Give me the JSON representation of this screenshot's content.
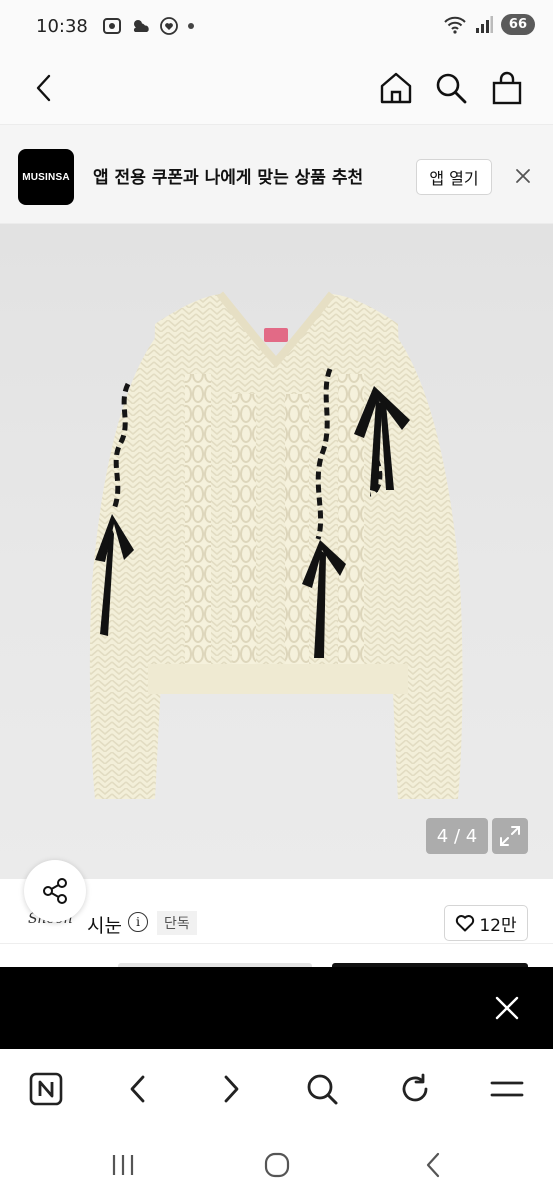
{
  "status_bar": {
    "time": "10:38",
    "left_icons": [
      "screenshot-icon",
      "weather-icon",
      "heart-icon",
      "dot-icon"
    ],
    "right_icons": [
      "wifi-icon",
      "signal-icon"
    ],
    "battery": "66"
  },
  "header": {
    "icons": [
      "back-arrow-icon",
      "home-icon",
      "search-icon",
      "shopping-bag-icon"
    ]
  },
  "app_banner": {
    "logo_text": "MUSINSA",
    "message": "앱 전용 쿠폰과 나에게 맞는 상품 추천",
    "open_button": "앱 열기"
  },
  "product_image": {
    "page_indicator": "4 / 4",
    "description": "cream cable-knit cardigan with black ribbon bows"
  },
  "brand": {
    "logo_text": "Shoon",
    "name": "시눈",
    "badge": "단독",
    "likes": "12만"
  },
  "browser_toolbar": {
    "icons": [
      "naver-home-icon",
      "back-icon",
      "forward-icon",
      "search-icon",
      "refresh-icon",
      "menu-icon"
    ]
  },
  "system_nav": {
    "icons": [
      "recent-apps-icon",
      "home-icon",
      "back-icon"
    ]
  },
  "colors": {
    "banner_bg": "#f5f5f5",
    "overlay_bar": "#000000",
    "badge_bg": "#f1f1f1",
    "sweater": "#f3efd9"
  }
}
